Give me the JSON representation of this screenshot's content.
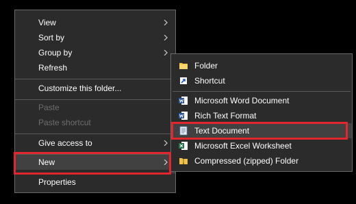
{
  "context_menu": {
    "items": [
      {
        "label": "View",
        "has_submenu": true
      },
      {
        "label": "Sort by",
        "has_submenu": true
      },
      {
        "label": "Group by",
        "has_submenu": true
      },
      {
        "label": "Refresh"
      },
      {
        "label": "Customize this folder..."
      },
      {
        "label": "Paste",
        "disabled": true
      },
      {
        "label": "Paste shortcut",
        "disabled": true
      },
      {
        "label": "Give access to",
        "has_submenu": true
      },
      {
        "label": "New",
        "has_submenu": true,
        "highlighted": true
      },
      {
        "label": "Properties"
      }
    ]
  },
  "new_submenu": {
    "items": [
      {
        "label": "Folder",
        "icon": "folder-icon"
      },
      {
        "label": "Shortcut",
        "icon": "shortcut-icon"
      },
      {
        "label": "Microsoft Word Document",
        "icon": "word-document-icon"
      },
      {
        "label": "Rich Text Format",
        "icon": "rich-text-icon"
      },
      {
        "label": "Text Document",
        "icon": "text-document-icon",
        "highlighted": true
      },
      {
        "label": "Microsoft Excel Worksheet",
        "icon": "excel-worksheet-icon"
      },
      {
        "label": "Compressed (zipped) Folder",
        "icon": "zip-folder-icon"
      }
    ]
  },
  "colors": {
    "menu_bg": "#2b2b2b",
    "highlight_bg": "#414141",
    "annotation_red": "#e3262e",
    "disabled_text": "#6d6d6d"
  }
}
